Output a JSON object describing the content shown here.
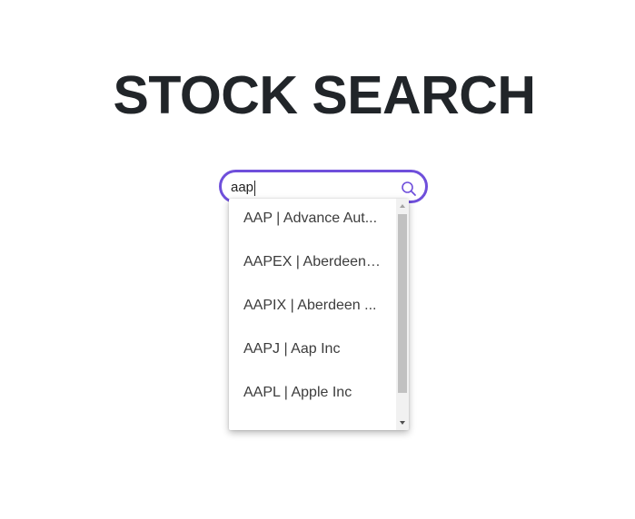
{
  "page": {
    "title": "STOCK SEARCH"
  },
  "search": {
    "value": "aap",
    "icon": "search-icon",
    "accent_color": "#6f4fdb"
  },
  "dropdown": {
    "options": [
      {
        "label": "AAP | Advance Aut..."
      },
      {
        "label": "AAPEX | Aberdeen ..."
      },
      {
        "label": "AAPIX | Aberdeen ..."
      },
      {
        "label": "AAPJ | Aap Inc"
      },
      {
        "label": "AAPL | Apple Inc"
      }
    ]
  }
}
